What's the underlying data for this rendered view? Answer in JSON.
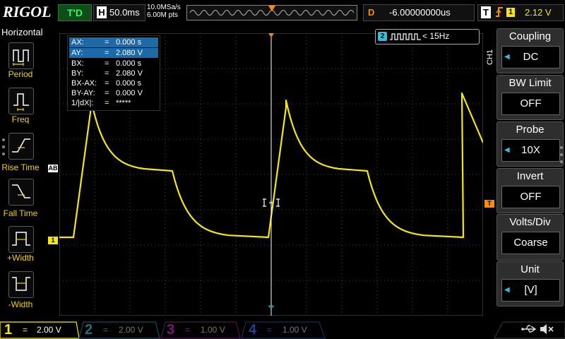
{
  "header": {
    "logo": "RIGOL",
    "trigger_status": "T'D",
    "horizontal": {
      "letter": "H",
      "timebase": "50.0ms"
    },
    "sample_rate": "10.0MSa/s",
    "memory_depth": "6.00M pts",
    "delay": {
      "letter": "D",
      "value": "-6.00000000us"
    },
    "trigger": {
      "letter": "T",
      "edge_icon": "rising-edge-icon",
      "source": "1",
      "level": "2.12 V"
    }
  },
  "left_menu": {
    "title": "Horizontal",
    "items": [
      {
        "label": "Period",
        "icon": "period-icon"
      },
      {
        "label": "Freq",
        "icon": "frequency-icon"
      },
      {
        "label": "Rise Time",
        "icon": "rise-time-icon"
      },
      {
        "label": "Fall Time",
        "icon": "fall-time-icon"
      },
      {
        "label": "+Width",
        "icon": "positive-width-icon"
      },
      {
        "label": "-Width",
        "icon": "negative-width-icon"
      }
    ]
  },
  "cursor_readout": {
    "rows": [
      {
        "key": "AX:",
        "eq": "=",
        "value": "0.000 s",
        "highlight": true
      },
      {
        "key": "AY:",
        "eq": "=",
        "value": "2.080 V",
        "highlight": true
      },
      {
        "key": "BX:",
        "eq": "=",
        "value": "0.000 s",
        "highlight": false
      },
      {
        "key": "BY:",
        "eq": "=",
        "value": "2.080 V",
        "highlight": false
      },
      {
        "key": "BX-AX:",
        "eq": "=",
        "value": "0.000 s",
        "highlight": false
      },
      {
        "key": "BY-AY:",
        "eq": "=",
        "value": "0.000 V",
        "highlight": false
      },
      {
        "key": "1/|dX|:",
        "eq": "=",
        "value": "*****",
        "highlight": false
      }
    ]
  },
  "frequency_counter": {
    "channel": "2",
    "text": "< 15Hz"
  },
  "markers": {
    "cursor_a": "A",
    "cursor_b": "B",
    "channel1": "1",
    "trigger": "T"
  },
  "right_menu": {
    "channel_tag": "CH1",
    "items": [
      {
        "title": "Coupling",
        "value": "DC",
        "has_arrow": true
      },
      {
        "title": "BW Limit",
        "value": "OFF",
        "has_arrow": false
      },
      {
        "title": "Probe",
        "value": "10X",
        "has_arrow": true
      },
      {
        "title": "Invert",
        "value": "OFF",
        "has_arrow": false
      },
      {
        "title": "Volts/Div",
        "value": "Coarse",
        "has_arrow": false
      },
      {
        "title": "Unit",
        "value": "[V]",
        "has_arrow": true
      }
    ]
  },
  "channels": [
    {
      "number": "1",
      "coupling": "=",
      "scale": "2.00 V",
      "color": "#f5e51a",
      "active": true
    },
    {
      "number": "2",
      "coupling": "=",
      "scale": "2.00 V",
      "color": "#2fc0e0",
      "active": false
    },
    {
      "number": "3",
      "coupling": "=",
      "scale": "1.00 V",
      "color": "#d020d0",
      "active": false
    },
    {
      "number": "4",
      "coupling": "=",
      "scale": "1.00 V",
      "color": "#2060ff",
      "active": false
    }
  ],
  "status_icons": [
    "usb-icon",
    "speaker-mute-icon"
  ],
  "colors": {
    "ch1": "#f5e51a",
    "ch2": "#2fc0e0",
    "trigger": "#ff8c00",
    "cursor": "#ffffff",
    "highlight": "#1e6aa8"
  }
}
